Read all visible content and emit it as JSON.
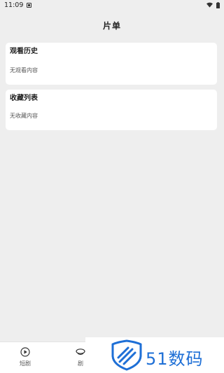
{
  "status_bar": {
    "time": "11:09"
  },
  "header": {
    "title": "片单"
  },
  "history": {
    "title": "观看历史",
    "empty_text": "无观看内容"
  },
  "favorites": {
    "title": "收藏列表",
    "empty_text": "无收藏内容"
  },
  "bottom_nav": {
    "items": [
      {
        "label": "短剧",
        "icon": "play-circle-icon"
      },
      {
        "label": "剧",
        "icon": "drama-icon"
      }
    ]
  },
  "watermark": {
    "text": "51数码",
    "color": "#1e6fd6"
  }
}
